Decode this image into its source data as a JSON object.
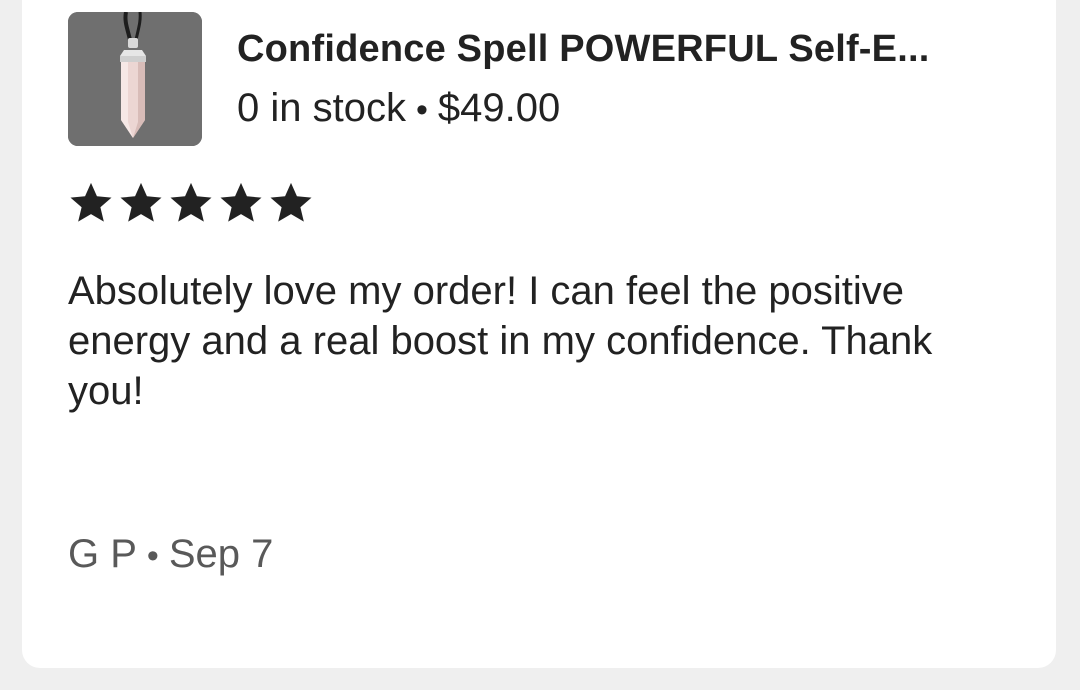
{
  "listing": {
    "title": "Confidence Spell POWERFUL Self-E...",
    "stock": "0 in stock",
    "separator": "•",
    "price": "$49.00",
    "image_icon": "pendant-photo"
  },
  "rating": {
    "value": 5,
    "max": 5,
    "icon": "star-icon"
  },
  "review": {
    "text": "Absolutely love my order! I can feel the positive energy and a real boost in my confidence. Thank you!"
  },
  "meta": {
    "author": "G P",
    "separator": "•",
    "date": "Sep 7"
  },
  "colors": {
    "text": "#222222",
    "meta_text": "#595959",
    "card": "#ffffff",
    "background": "#efefef"
  }
}
